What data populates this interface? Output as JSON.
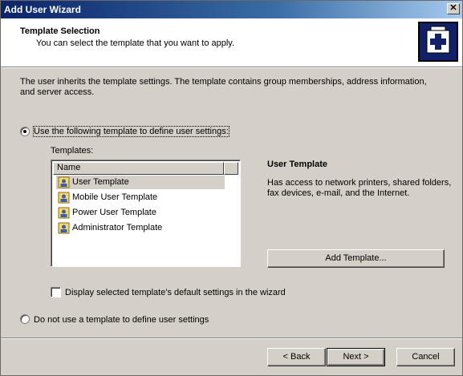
{
  "window": {
    "title": "Add User Wizard",
    "close_glyph": "✕"
  },
  "header": {
    "title": "Template Selection",
    "subtitle": "You can select the template that you want to apply.",
    "icon": "add-user-icon"
  },
  "intro_text": "The user inherits the template settings. The template contains group memberships, address information, and server access.",
  "options": {
    "use_template": {
      "label": "Use the following template to define user settings:",
      "checked": true
    },
    "no_template": {
      "label": "Do not use a template to define user settings",
      "checked": false
    }
  },
  "templates": {
    "label": "Templates:",
    "column_header": "Name",
    "items": [
      {
        "name": "User Template",
        "selected": true
      },
      {
        "name": "Mobile User Template",
        "selected": false
      },
      {
        "name": "Power User Template",
        "selected": false
      },
      {
        "name": "Administrator Template",
        "selected": false
      }
    ]
  },
  "description": {
    "title": "User Template",
    "text": "Has access to network printers, shared folders, fax devices, e-mail, and the Internet."
  },
  "add_template_button": "Add Template...",
  "display_checkbox": {
    "label": "Display selected template's default settings in the wizard",
    "checked": false
  },
  "buttons": {
    "back": "< Back",
    "next": "Next >",
    "cancel": "Cancel"
  },
  "colors": {
    "titlebar_start": "#0a246a",
    "titlebar_end": "#a6caf0",
    "face": "#d4d0c8",
    "icon_bg": "#10206b"
  }
}
